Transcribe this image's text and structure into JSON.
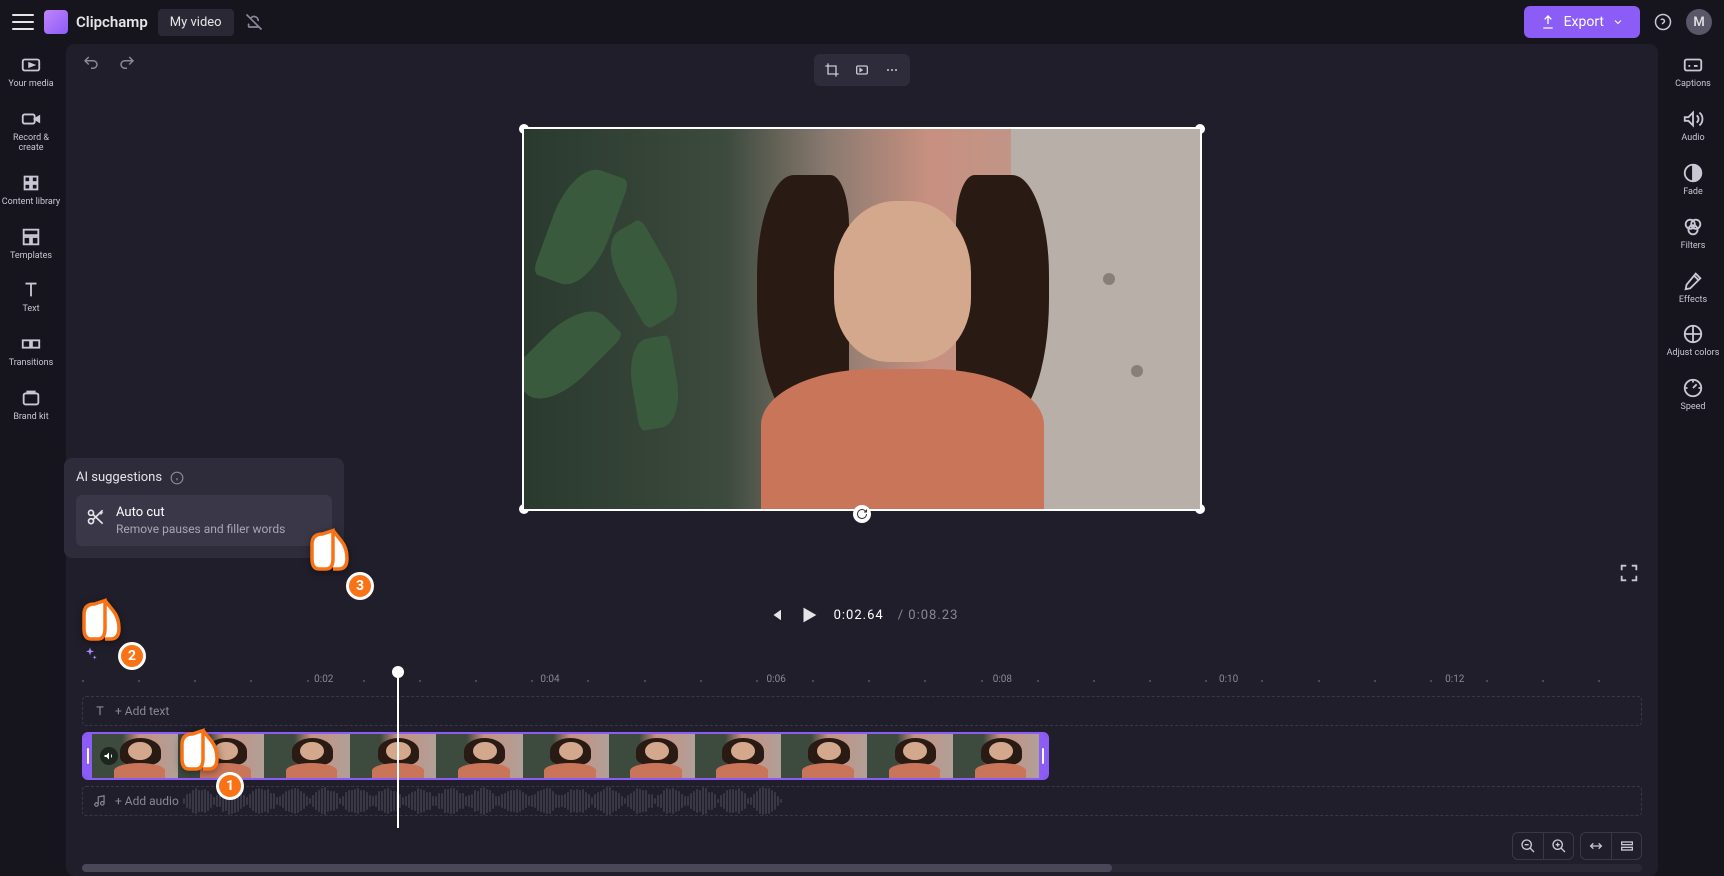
{
  "app": {
    "name": "Clipchamp",
    "project": "My video"
  },
  "topbar": {
    "export": "Export",
    "avatar_initial": "M"
  },
  "left_rail": [
    {
      "id": "your-media",
      "label": "Your media"
    },
    {
      "id": "record-create",
      "label": "Record & create"
    },
    {
      "id": "content-library",
      "label": "Content library"
    },
    {
      "id": "templates",
      "label": "Templates"
    },
    {
      "id": "text",
      "label": "Text"
    },
    {
      "id": "transitions",
      "label": "Transitions"
    },
    {
      "id": "brand-kit",
      "label": "Brand kit"
    }
  ],
  "right_rail": [
    {
      "id": "captions",
      "label": "Captions"
    },
    {
      "id": "audio",
      "label": "Audio"
    },
    {
      "id": "fade",
      "label": "Fade"
    },
    {
      "id": "filters",
      "label": "Filters"
    },
    {
      "id": "effects",
      "label": "Effects"
    },
    {
      "id": "adjust-colors",
      "label": "Adjust colors"
    },
    {
      "id": "speed",
      "label": "Speed"
    }
  ],
  "playback": {
    "current": "0:02.64",
    "sep": " / ",
    "total": "0:08.23"
  },
  "ruler": [
    {
      "pos": 15.5,
      "label": "0:02"
    },
    {
      "pos": 30,
      "label": "0:04"
    },
    {
      "pos": 44.5,
      "label": "0:06"
    },
    {
      "pos": 59,
      "label": "0:08"
    },
    {
      "pos": 73.5,
      "label": "0:10"
    },
    {
      "pos": 88,
      "label": "0:12"
    }
  ],
  "tracks": {
    "text": "+ Add text",
    "audio": "+ Add audio"
  },
  "ai": {
    "title": "AI suggestions",
    "item_title": "Auto cut",
    "item_sub": "Remove pauses and filler words"
  },
  "pointers": {
    "p1": "1",
    "p2": "2",
    "p3": "3"
  },
  "colors": {
    "accent": "#8b5cf6",
    "pointer": "#f97316"
  }
}
